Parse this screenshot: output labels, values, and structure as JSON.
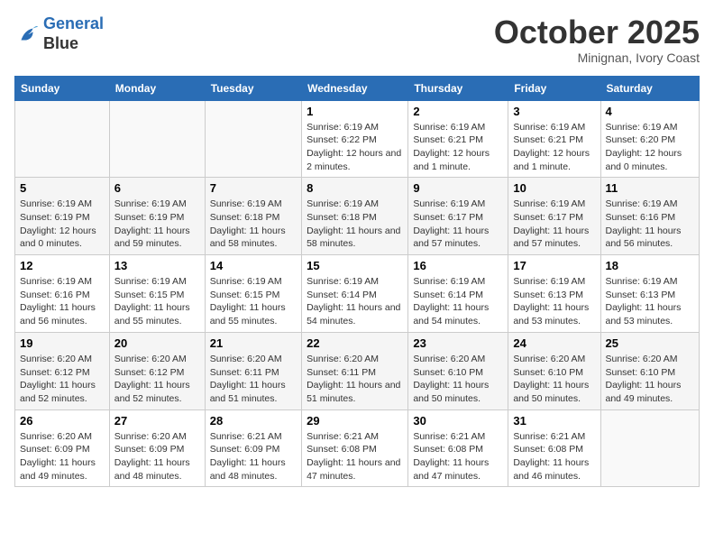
{
  "logo": {
    "line1": "General",
    "line2": "Blue"
  },
  "title": "October 2025",
  "subtitle": "Minignan, Ivory Coast",
  "days_of_week": [
    "Sunday",
    "Monday",
    "Tuesday",
    "Wednesday",
    "Thursday",
    "Friday",
    "Saturday"
  ],
  "weeks": [
    [
      {
        "day": "",
        "info": ""
      },
      {
        "day": "",
        "info": ""
      },
      {
        "day": "",
        "info": ""
      },
      {
        "day": "1",
        "info": "Sunrise: 6:19 AM\nSunset: 6:22 PM\nDaylight: 12 hours and 2 minutes."
      },
      {
        "day": "2",
        "info": "Sunrise: 6:19 AM\nSunset: 6:21 PM\nDaylight: 12 hours and 1 minute."
      },
      {
        "day": "3",
        "info": "Sunrise: 6:19 AM\nSunset: 6:21 PM\nDaylight: 12 hours and 1 minute."
      },
      {
        "day": "4",
        "info": "Sunrise: 6:19 AM\nSunset: 6:20 PM\nDaylight: 12 hours and 0 minutes."
      }
    ],
    [
      {
        "day": "5",
        "info": "Sunrise: 6:19 AM\nSunset: 6:19 PM\nDaylight: 12 hours and 0 minutes."
      },
      {
        "day": "6",
        "info": "Sunrise: 6:19 AM\nSunset: 6:19 PM\nDaylight: 11 hours and 59 minutes."
      },
      {
        "day": "7",
        "info": "Sunrise: 6:19 AM\nSunset: 6:18 PM\nDaylight: 11 hours and 58 minutes."
      },
      {
        "day": "8",
        "info": "Sunrise: 6:19 AM\nSunset: 6:18 PM\nDaylight: 11 hours and 58 minutes."
      },
      {
        "day": "9",
        "info": "Sunrise: 6:19 AM\nSunset: 6:17 PM\nDaylight: 11 hours and 57 minutes."
      },
      {
        "day": "10",
        "info": "Sunrise: 6:19 AM\nSunset: 6:17 PM\nDaylight: 11 hours and 57 minutes."
      },
      {
        "day": "11",
        "info": "Sunrise: 6:19 AM\nSunset: 6:16 PM\nDaylight: 11 hours and 56 minutes."
      }
    ],
    [
      {
        "day": "12",
        "info": "Sunrise: 6:19 AM\nSunset: 6:16 PM\nDaylight: 11 hours and 56 minutes."
      },
      {
        "day": "13",
        "info": "Sunrise: 6:19 AM\nSunset: 6:15 PM\nDaylight: 11 hours and 55 minutes."
      },
      {
        "day": "14",
        "info": "Sunrise: 6:19 AM\nSunset: 6:15 PM\nDaylight: 11 hours and 55 minutes."
      },
      {
        "day": "15",
        "info": "Sunrise: 6:19 AM\nSunset: 6:14 PM\nDaylight: 11 hours and 54 minutes."
      },
      {
        "day": "16",
        "info": "Sunrise: 6:19 AM\nSunset: 6:14 PM\nDaylight: 11 hours and 54 minutes."
      },
      {
        "day": "17",
        "info": "Sunrise: 6:19 AM\nSunset: 6:13 PM\nDaylight: 11 hours and 53 minutes."
      },
      {
        "day": "18",
        "info": "Sunrise: 6:19 AM\nSunset: 6:13 PM\nDaylight: 11 hours and 53 minutes."
      }
    ],
    [
      {
        "day": "19",
        "info": "Sunrise: 6:20 AM\nSunset: 6:12 PM\nDaylight: 11 hours and 52 minutes."
      },
      {
        "day": "20",
        "info": "Sunrise: 6:20 AM\nSunset: 6:12 PM\nDaylight: 11 hours and 52 minutes."
      },
      {
        "day": "21",
        "info": "Sunrise: 6:20 AM\nSunset: 6:11 PM\nDaylight: 11 hours and 51 minutes."
      },
      {
        "day": "22",
        "info": "Sunrise: 6:20 AM\nSunset: 6:11 PM\nDaylight: 11 hours and 51 minutes."
      },
      {
        "day": "23",
        "info": "Sunrise: 6:20 AM\nSunset: 6:10 PM\nDaylight: 11 hours and 50 minutes."
      },
      {
        "day": "24",
        "info": "Sunrise: 6:20 AM\nSunset: 6:10 PM\nDaylight: 11 hours and 50 minutes."
      },
      {
        "day": "25",
        "info": "Sunrise: 6:20 AM\nSunset: 6:10 PM\nDaylight: 11 hours and 49 minutes."
      }
    ],
    [
      {
        "day": "26",
        "info": "Sunrise: 6:20 AM\nSunset: 6:09 PM\nDaylight: 11 hours and 49 minutes."
      },
      {
        "day": "27",
        "info": "Sunrise: 6:20 AM\nSunset: 6:09 PM\nDaylight: 11 hours and 48 minutes."
      },
      {
        "day": "28",
        "info": "Sunrise: 6:21 AM\nSunset: 6:09 PM\nDaylight: 11 hours and 48 minutes."
      },
      {
        "day": "29",
        "info": "Sunrise: 6:21 AM\nSunset: 6:08 PM\nDaylight: 11 hours and 47 minutes."
      },
      {
        "day": "30",
        "info": "Sunrise: 6:21 AM\nSunset: 6:08 PM\nDaylight: 11 hours and 47 minutes."
      },
      {
        "day": "31",
        "info": "Sunrise: 6:21 AM\nSunset: 6:08 PM\nDaylight: 11 hours and 46 minutes."
      },
      {
        "day": "",
        "info": ""
      }
    ]
  ]
}
